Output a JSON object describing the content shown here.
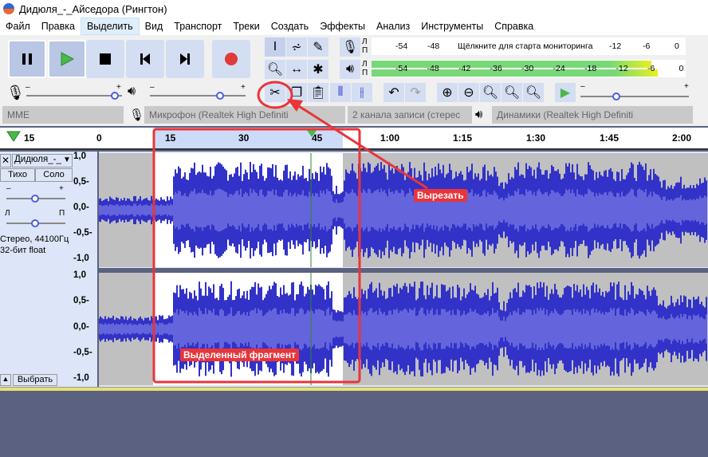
{
  "window": {
    "title": "Дидюля_-_Айседора (Рингтон)"
  },
  "menu": [
    "Файл",
    "Правка",
    "Выделить",
    "Вид",
    "Транспорт",
    "Треки",
    "Создать",
    "Эффекты",
    "Анализ",
    "Инструменты",
    "Справка"
  ],
  "meters": {
    "record_ch": [
      "Л",
      "П"
    ],
    "play_ch": [
      "Л",
      "П"
    ],
    "record_prompt": "Щёлкните для старта мониторинга",
    "record_ticks": [
      "-54",
      "-48",
      "-12",
      "-6",
      "0"
    ],
    "play_ticks": [
      "-54",
      "-48",
      "-42",
      "-36",
      "-30",
      "-24",
      "-18",
      "-12",
      "-6",
      "0"
    ],
    "play_level_left": 0.89,
    "play_level_right": 0.91
  },
  "mixer": {
    "minus": "–",
    "plus": "+"
  },
  "devices": {
    "host": "MME",
    "mic": "Микрофон (Realtek High Definiti",
    "channels": "2  канала записи (стерес",
    "speaker": "Динамики (Realtek High Definiti"
  },
  "ruler": {
    "labels": [
      "15",
      "0",
      "15",
      "30",
      "45",
      "1:00",
      "1:15",
      "1:30",
      "1:45",
      "2:00"
    ]
  },
  "track": {
    "name": "Дидюля_-_",
    "mute": "Тихо",
    "solo": "Соло",
    "gain_minus": "–",
    "gain_plus": "+",
    "pan_left": "Л",
    "pan_right": "П",
    "info1": "Стерео, 44100Гц",
    "info2": "32-бит float",
    "select": "Выбрать",
    "scale": [
      "1,0",
      "0,5-",
      "0,0-",
      "-0,5-",
      "-1,0"
    ]
  },
  "annotations": {
    "cut": "Вырезать",
    "selection": "Выделенный фрагмент"
  },
  "colors": {
    "wave": "#3232c8",
    "rms": "#6464dc",
    "selected_bg": "#ffffff",
    "unselected_bg": "#c0c0c0",
    "annotation": "#e8353a"
  }
}
